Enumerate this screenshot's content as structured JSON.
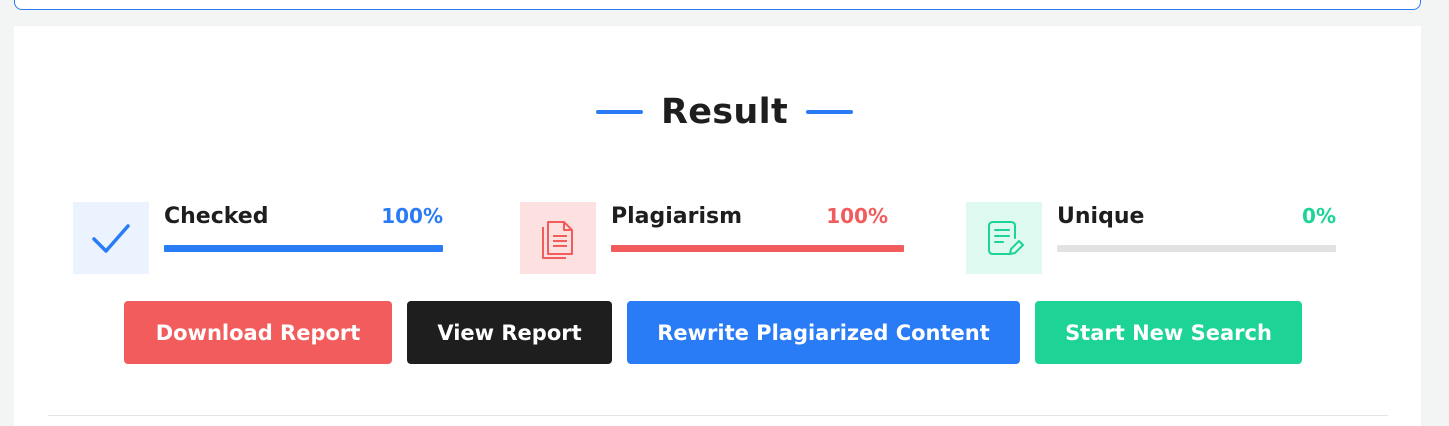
{
  "result": {
    "title": "Result"
  },
  "colors": {
    "blue": "#2a7cf6",
    "red": "#f25c5c",
    "green": "#1dd396",
    "dark": "#1e1e1e"
  },
  "stats": {
    "checked": {
      "label": "Checked",
      "value": "100%",
      "progress_percent": 100,
      "icon": "checkmark-icon"
    },
    "plagiarism": {
      "label": "Plagiarism",
      "value": "100%",
      "progress_percent": 100,
      "icon": "copy-documents-icon"
    },
    "unique": {
      "label": "Unique",
      "value": "0%",
      "progress_percent": 0,
      "icon": "edit-document-icon"
    }
  },
  "actions": {
    "download_report": "Download Report",
    "view_report": "View Report",
    "rewrite": "Rewrite Plagiarized Content",
    "new_search": "Start New Search"
  }
}
